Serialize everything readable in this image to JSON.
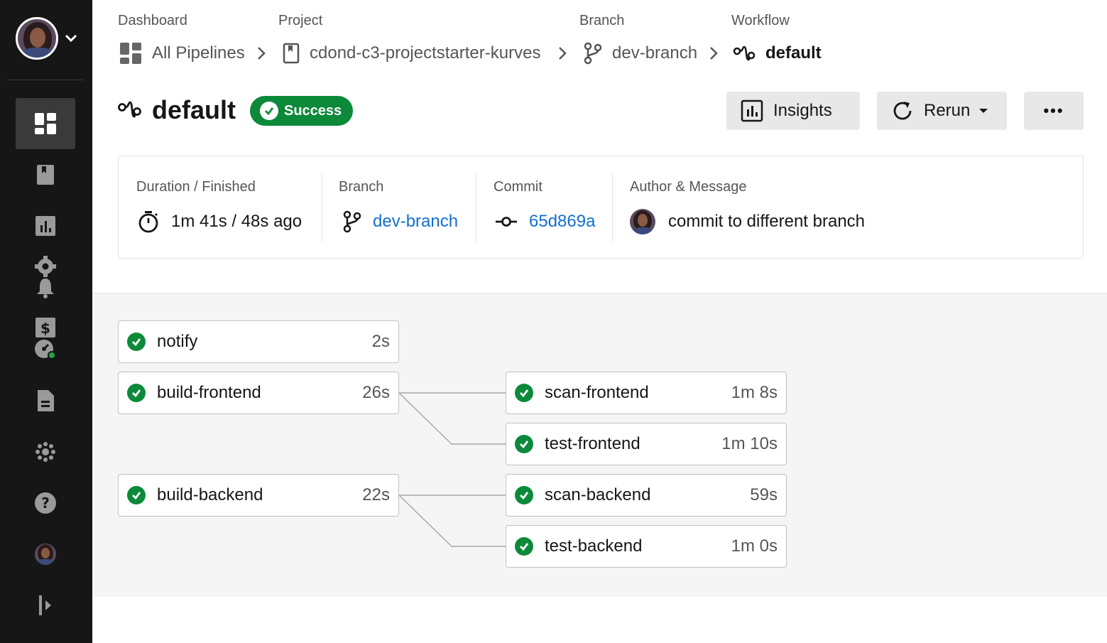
{
  "sidebar": {
    "items": [
      {
        "icon": "dashboard-icon",
        "active": true
      },
      {
        "icon": "projects-icon"
      },
      {
        "icon": "insights-icon"
      },
      {
        "icon": "settings-icon"
      },
      {
        "icon": "notifications-icon"
      },
      {
        "icon": "billing-icon"
      },
      {
        "icon": "status-icon"
      },
      {
        "icon": "docs-icon"
      },
      {
        "icon": "community-icon"
      },
      {
        "icon": "help-icon"
      },
      {
        "icon": "user-avatar-icon"
      },
      {
        "icon": "expand-sidebar-icon"
      }
    ]
  },
  "breadcrumb": {
    "dashboard": {
      "label": "Dashboard",
      "value": "All Pipelines"
    },
    "project": {
      "label": "Project",
      "value": "cdond-c3-projectstarter-kurves"
    },
    "branch": {
      "label": "Branch",
      "value": "dev-branch"
    },
    "workflow": {
      "label": "Workflow",
      "value": "default"
    }
  },
  "header": {
    "title": "default",
    "status": "Success",
    "insights_label": "Insights",
    "rerun_label": "Rerun",
    "more_label": "•••"
  },
  "summary": {
    "duration_label": "Duration / Finished",
    "duration_value": "1m 41s / 48s ago",
    "branch_label": "Branch",
    "branch_value": "dev-branch",
    "commit_label": "Commit",
    "commit_value": "65d869a",
    "author_label": "Author & Message",
    "author_message": "commit to different branch"
  },
  "jobs": [
    {
      "name": "notify",
      "duration": "2s",
      "status": "success"
    },
    {
      "name": "build-frontend",
      "duration": "26s",
      "status": "success"
    },
    {
      "name": "scan-frontend",
      "duration": "1m 8s",
      "status": "success"
    },
    {
      "name": "test-frontend",
      "duration": "1m 10s",
      "status": "success"
    },
    {
      "name": "build-backend",
      "duration": "22s",
      "status": "success"
    },
    {
      "name": "scan-backend",
      "duration": "59s",
      "status": "success"
    },
    {
      "name": "test-backend",
      "duration": "1m 0s",
      "status": "success"
    }
  ],
  "colors": {
    "success": "#0c8a3a",
    "link": "#1270d1",
    "sidebar": "#161616"
  }
}
